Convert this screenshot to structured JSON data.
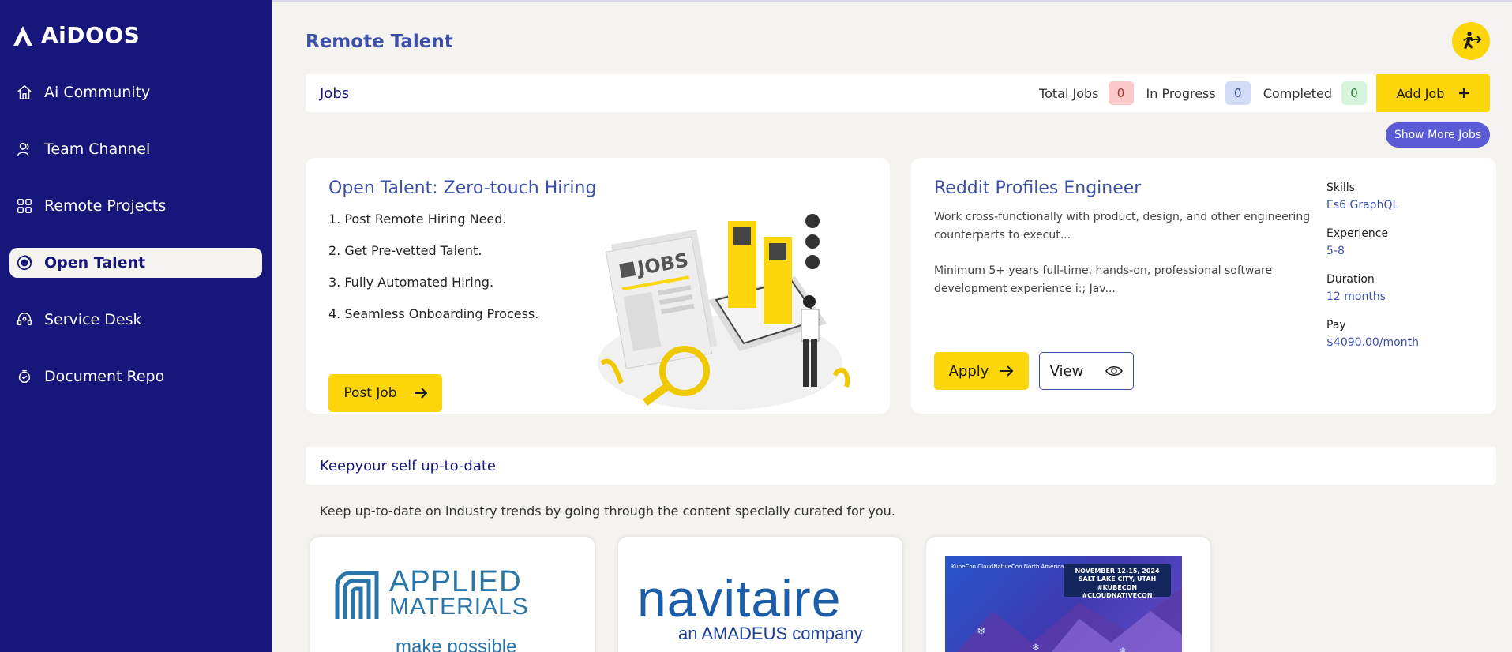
{
  "brand": {
    "name": "AiDOOS"
  },
  "sidebar": {
    "items": [
      {
        "label": "Ai Community",
        "icon": "home-icon",
        "active": false
      },
      {
        "label": "Team Channel",
        "icon": "users-icon",
        "active": false
      },
      {
        "label": "Remote Projects",
        "icon": "grid-icon",
        "active": false
      },
      {
        "label": "Open Talent",
        "icon": "talent-icon",
        "active": true
      },
      {
        "label": "Service Desk",
        "icon": "headset-icon",
        "active": false
      },
      {
        "label": "Document Repo",
        "icon": "document-icon",
        "active": false
      }
    ]
  },
  "header": {
    "title": "Remote Talent",
    "action_icon": "person-running-icon"
  },
  "jobs": {
    "title": "Jobs",
    "total_label": "Total Jobs",
    "total_value": "0",
    "progress_label": "In Progress",
    "progress_value": "0",
    "completed_label": "Completed",
    "completed_value": "0",
    "add_label": "Add Job",
    "show_more_label": "Show More Jobs"
  },
  "hiring_card": {
    "title": "Open Talent: Zero-touch Hiring",
    "steps": [
      "1. Post Remote Hiring Need.",
      "2. Get Pre-vetted Talent.",
      "3. Fully Automated Hiring.",
      "4. Seamless Onboarding Process."
    ],
    "post_label": "Post Job",
    "illustration_text": "JOBS"
  },
  "job_card": {
    "title": "Reddit Profiles Engineer",
    "desc1": "Work cross-functionally with product, design, and other engineering counterparts to execut...",
    "desc2": "Minimum 5+ years full-time, hands-on, professional software development experience i:; Jav...",
    "apply_label": "Apply",
    "view_label": "View",
    "skills_label": "Skills",
    "skills_value": "Es6 GraphQL",
    "experience_label": "Experience",
    "experience_value": "5-8",
    "duration_label": "Duration",
    "duration_value": "12 months",
    "pay_label": "Pay",
    "pay_value": "$4090.00/month"
  },
  "updates": {
    "title": "Keepyour self up-to-date",
    "description": "Keep up-to-date on industry trends by going through the content specially curated for you.",
    "thumbs": [
      {
        "l1": "APPLIED",
        "l2": "MATERIALS",
        "l3": "make possible"
      },
      {
        "l1": "navitaire",
        "l2": "an AMADEUS company"
      },
      {
        "l1": "NOVEMBER 12-15, 2024",
        "l2": "SALT LAKE CITY, UTAH",
        "l3": "#KUBECON #CLOUDNATIVECON",
        "l4": "KubeCon CloudNativeCon North America 2024"
      }
    ]
  },
  "colors": {
    "sidebar": "#17167a",
    "accent": "#fcd50a",
    "title": "#3b4fa8",
    "pill": "#5b5bd6"
  }
}
